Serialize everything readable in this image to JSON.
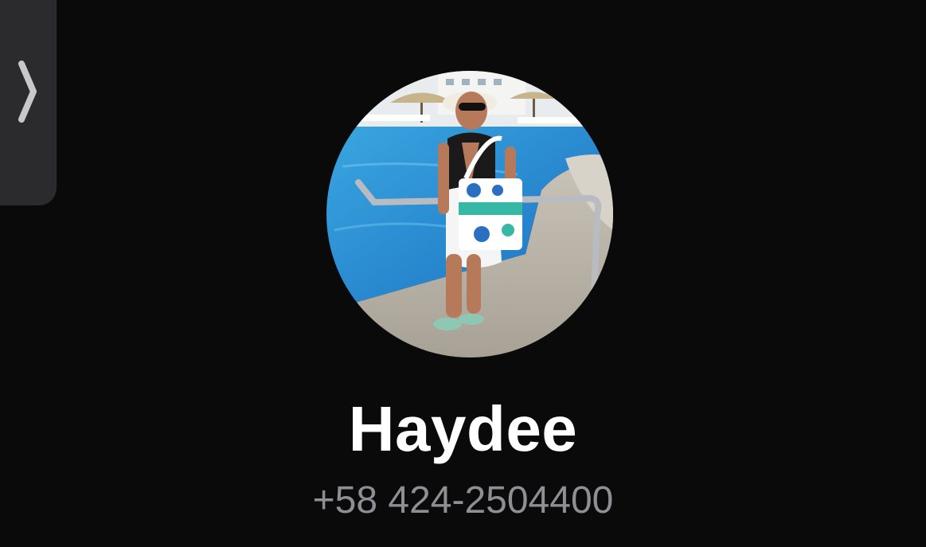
{
  "contact": {
    "name": "Haydee",
    "phone": "+58 424-2504400"
  },
  "side_handle": {
    "icon": "chevron-right-icon"
  },
  "avatar": {
    "icon": "contact-photo"
  },
  "colors": {
    "background": "#0a0a0a",
    "handle": "#2b2b2d",
    "name_text": "#ffffff",
    "phone_text": "#8e8e93",
    "chevron": "#c7c7cc"
  }
}
